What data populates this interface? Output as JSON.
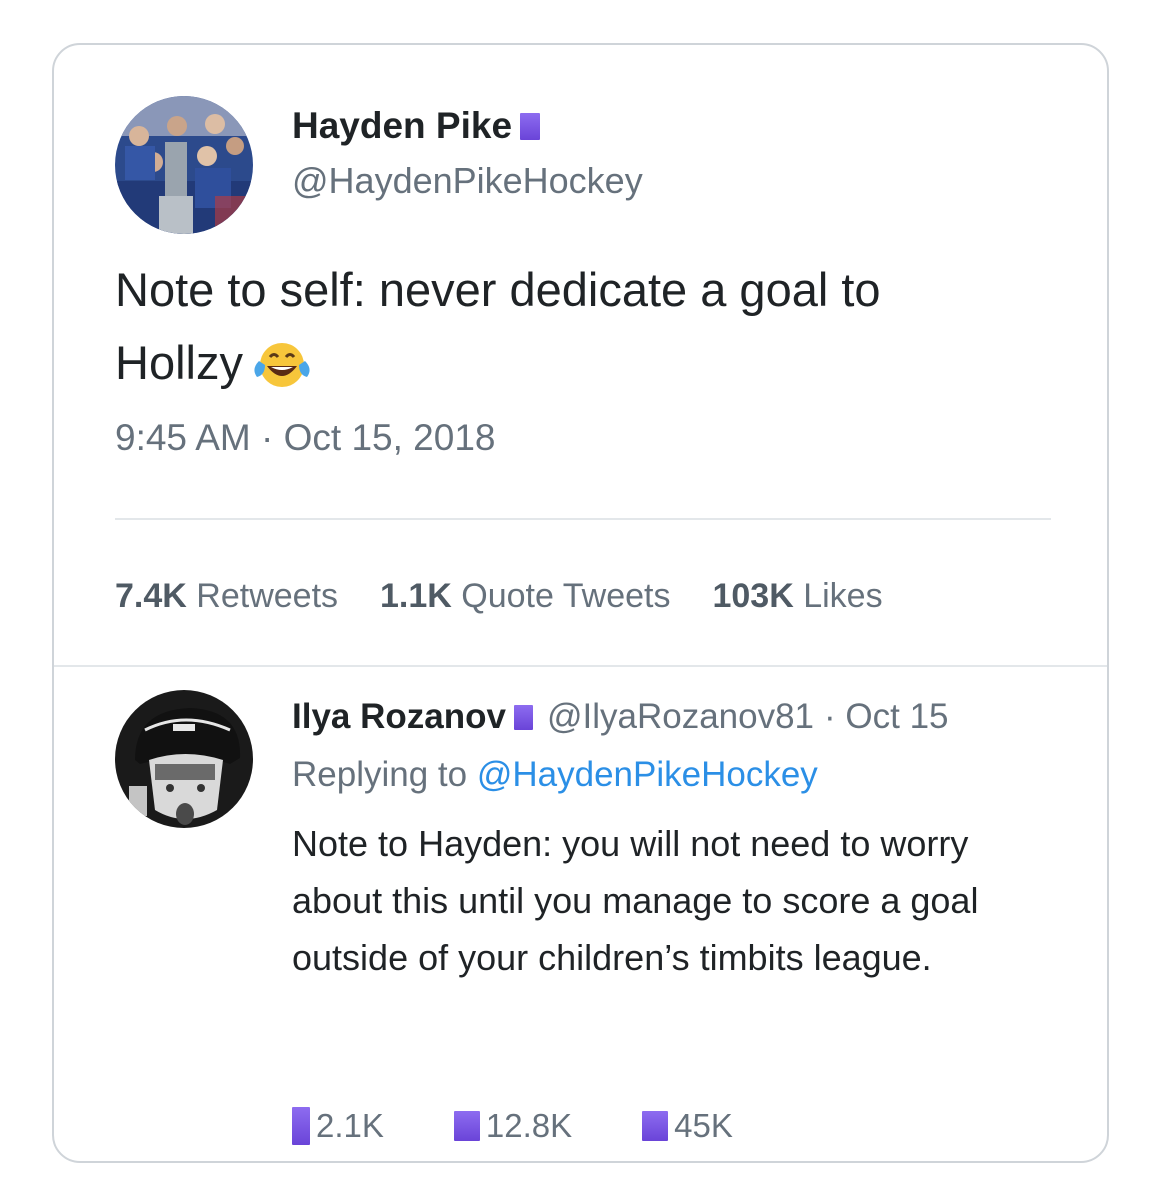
{
  "tweet": {
    "author_name": "Hayden Pike",
    "author_handle": "@HaydenPikeHockey",
    "text_line1": "Note to self: never dedicate a goal to",
    "text_line2": "Hollzy",
    "emoji": "face-with-tears-of-joy",
    "timestamp": "9:45 AM · Oct 15, 2018",
    "stats": {
      "retweets_count": "7.4K",
      "retweets_label": "Retweets",
      "quotes_count": "1.1K",
      "quotes_label": "Quote Tweets",
      "likes_count": "103K",
      "likes_label": "Likes"
    }
  },
  "reply": {
    "author_name": "Ilya Rozanov",
    "author_handle": "@IlyaRozanov81",
    "date": "· Oct 15",
    "replying_prefix": "Replying to",
    "replying_to": "@HaydenPikeHockey",
    "text": "Note to Hayden: you will not need to worry about this until you manage to score a goal outside of your children’s timbits league.",
    "actions": {
      "replies": "2.1K",
      "retweets": "12.8K",
      "likes": "45K"
    }
  },
  "colors": {
    "badge": "#7b57e6",
    "link": "#2b8fe6",
    "muted": "#66717c",
    "border": "#cfd4d9"
  }
}
